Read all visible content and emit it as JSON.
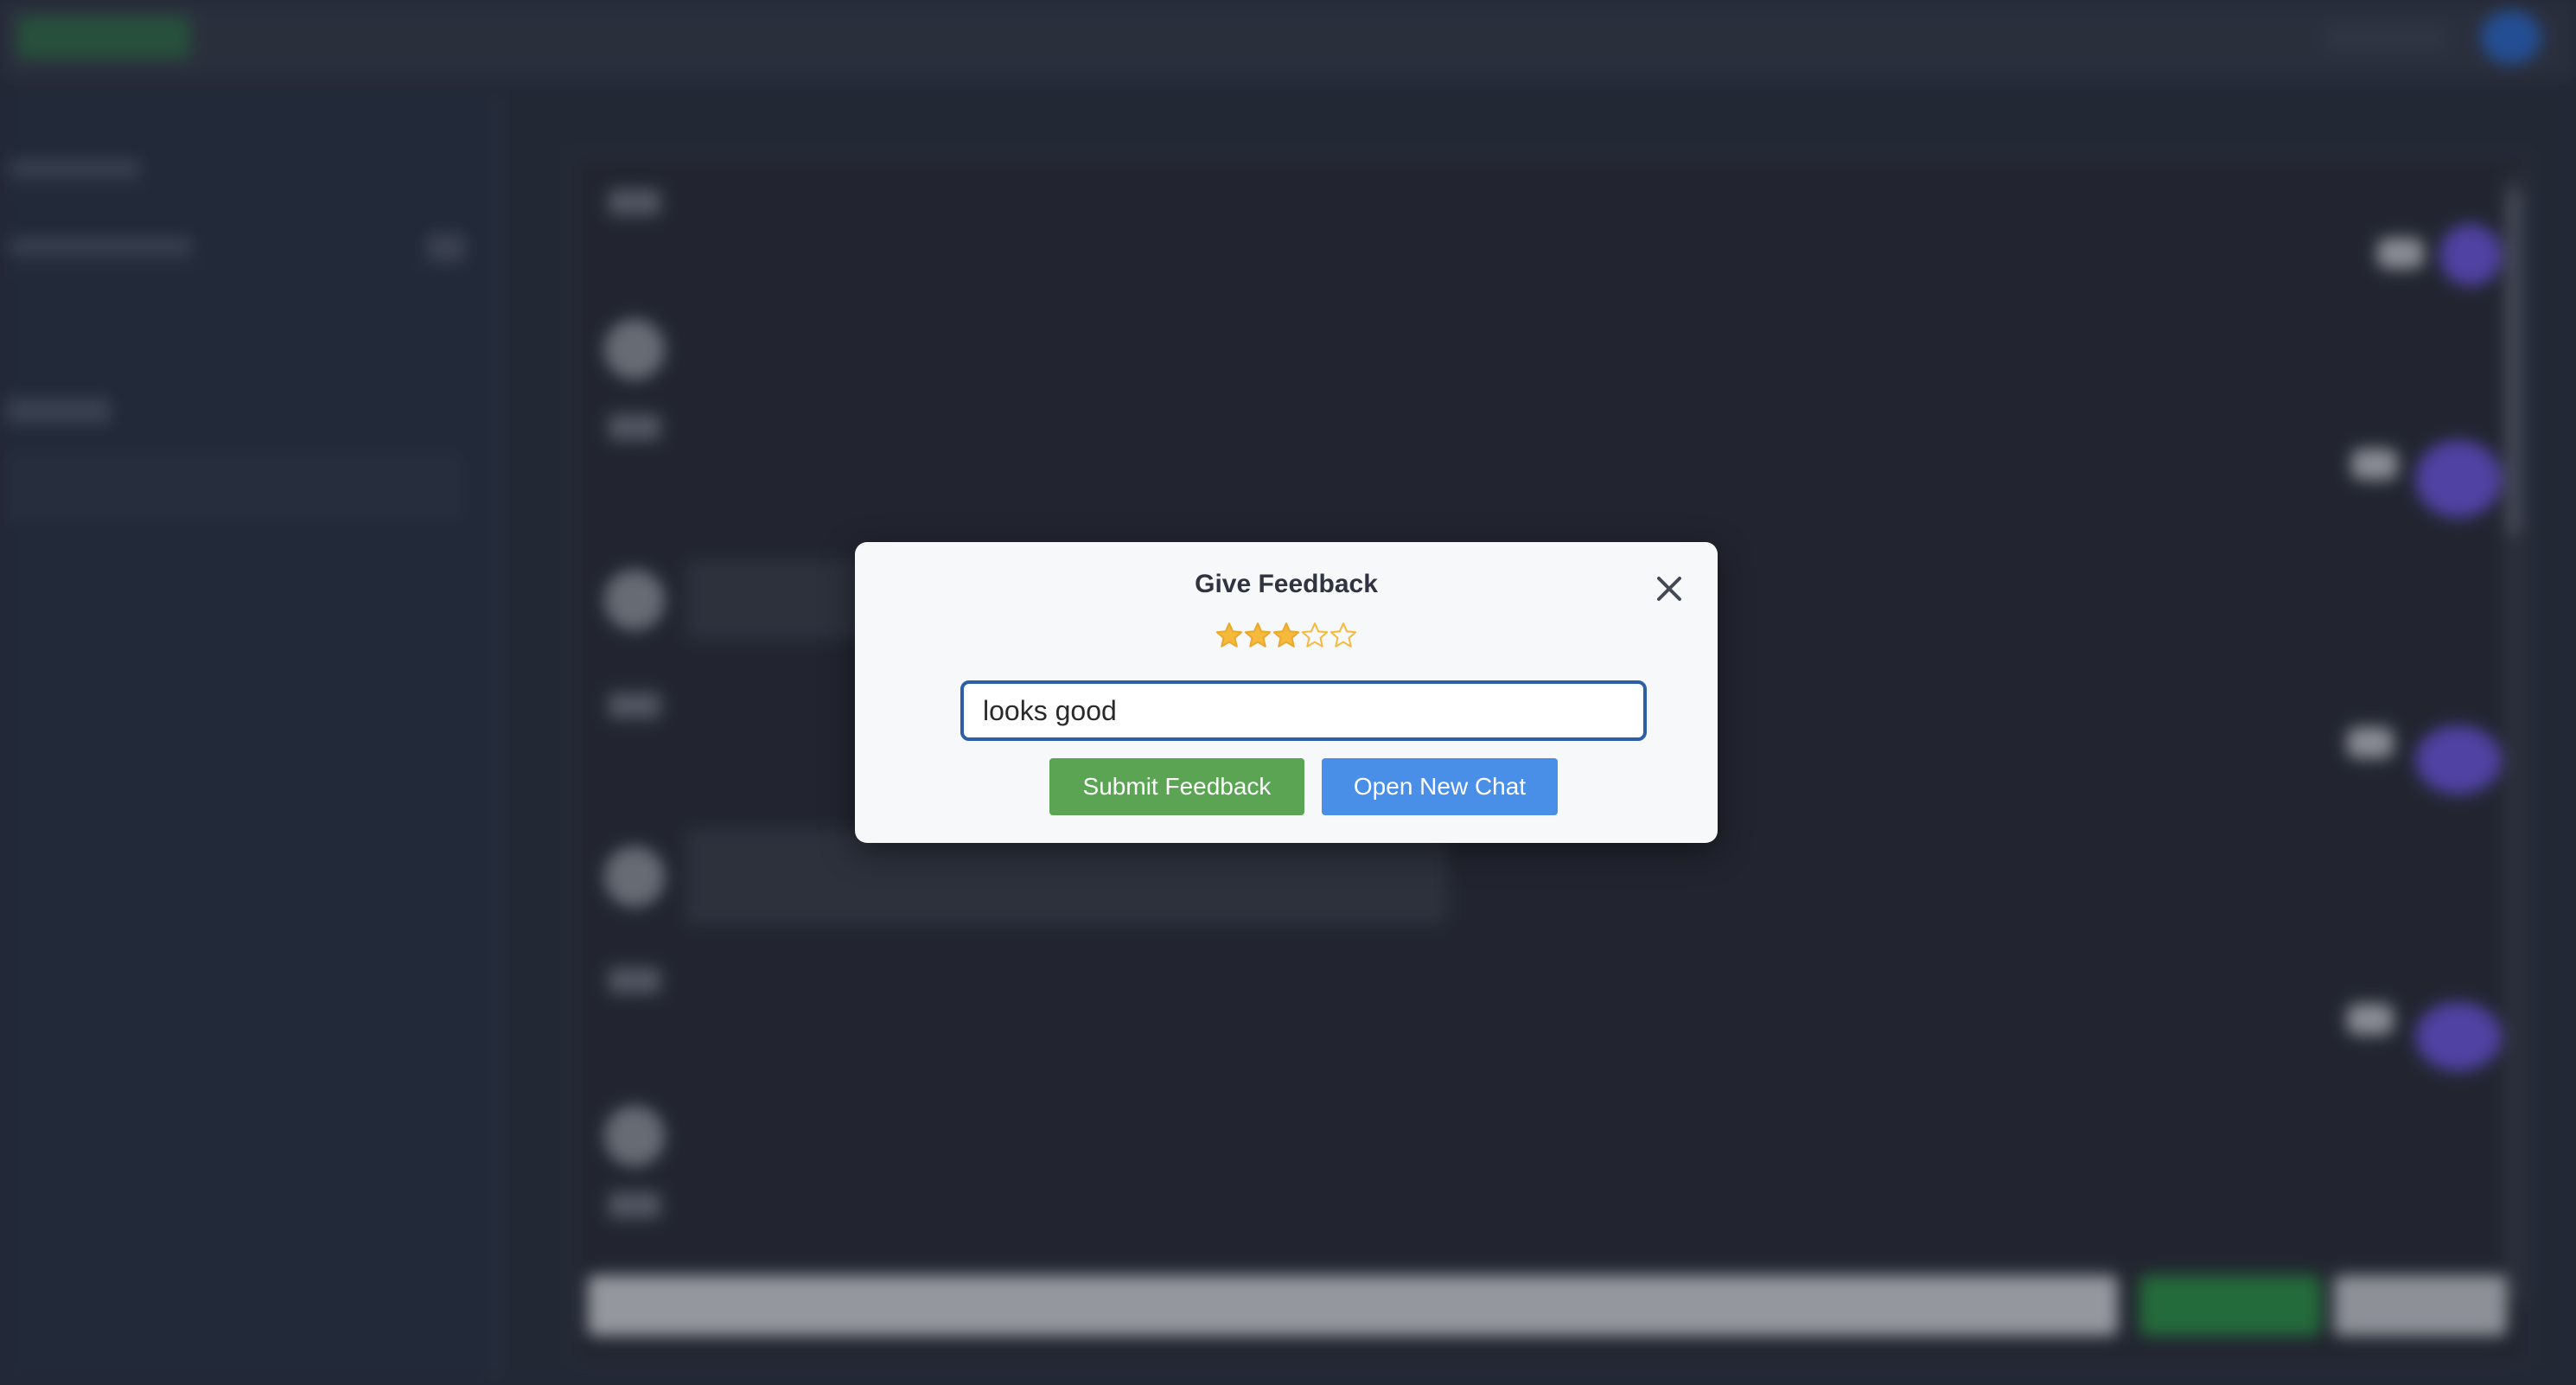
{
  "modal": {
    "title": "Give Feedback",
    "close_icon": "close-icon",
    "rating": {
      "value": 3,
      "max": 5,
      "filled_color": "#f6b93b",
      "empty_color": "#f6b93b"
    },
    "feedback_value": "looks good",
    "submit_label": "Submit Feedback",
    "new_chat_label": "Open New Chat"
  },
  "colors": {
    "submit_button": "#5aa454",
    "new_chat_button": "#4a8fe7",
    "input_border": "#2d5ea8",
    "modal_background": "#f7f8fa"
  }
}
